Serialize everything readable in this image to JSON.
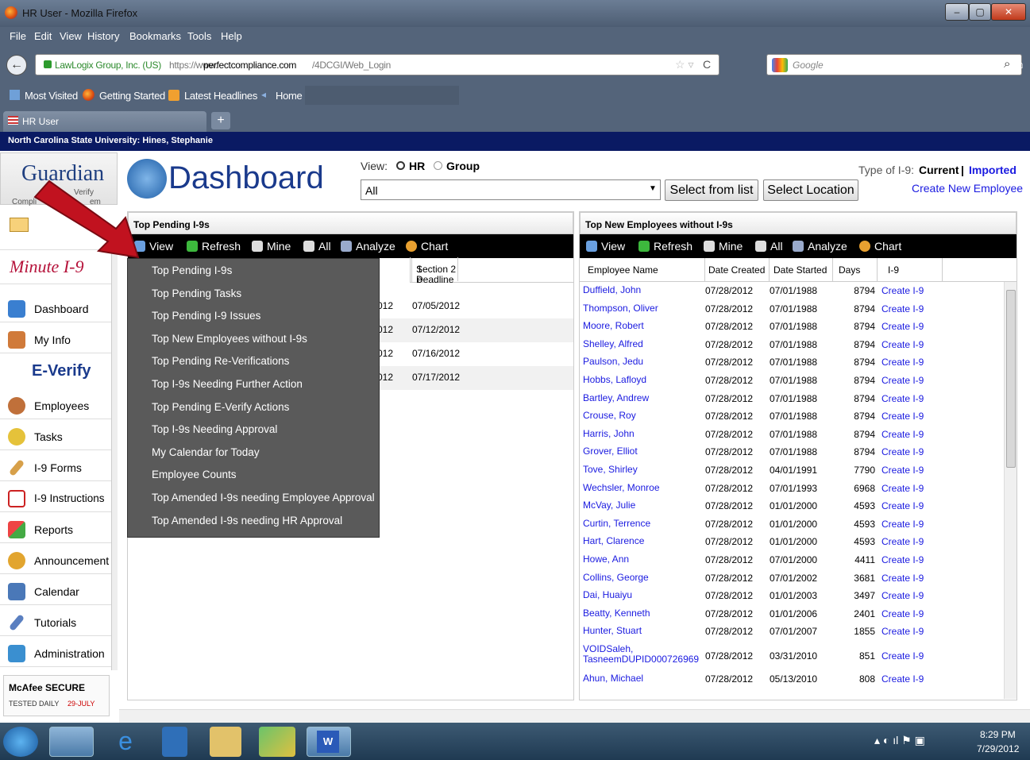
{
  "window": {
    "title": "HR User - Mozilla Firefox",
    "controls": [
      "–",
      "▢",
      "✕"
    ]
  },
  "menubar": [
    "File",
    "Edit",
    "View",
    "History",
    "Bookmarks",
    "Tools",
    "Help"
  ],
  "navbar": {
    "site_id": "LawLogix Group, Inc. (US)",
    "url_prefix": "https://www.",
    "url_domain": "perfectcompliance.com",
    "url_path": "/4DCGI/Web_Login",
    "search_placeholder": "Google"
  },
  "bookmarks": [
    "Most Visited",
    "Getting Started",
    "Latest Headlines",
    "Home"
  ],
  "tab": {
    "label": "HR User",
    "new_tab": "+"
  },
  "university_bar": "North Carolina State University: Hines, Stephanie",
  "sidebar": {
    "logo_text": "Guardian",
    "logo_sub1": "Verify",
    "logo_sub2": "Compli",
    "logo_sub3": "em",
    "minute_logo": "Minute I-9",
    "everify_logo": "E-Verify",
    "items": [
      {
        "label": "Dashboard"
      },
      {
        "label": "My Info"
      },
      {
        "label": "Employees"
      },
      {
        "label": "Tasks"
      },
      {
        "label": "I-9 Forms"
      },
      {
        "label": "I-9 Instructions"
      },
      {
        "label": "Reports"
      },
      {
        "label": "Announcement"
      },
      {
        "label": "Calendar"
      },
      {
        "label": "Tutorials"
      },
      {
        "label": "Administration"
      }
    ],
    "mcafee_title": "McAfee SECURE",
    "mcafee_sub": "TESTED DAILY",
    "mcafee_date": "29-JULY"
  },
  "header": {
    "title": "Dashboard",
    "view_label": "View:",
    "view_options": [
      "HR",
      "Group"
    ],
    "select_value": "All",
    "select_from_list": "Select from list",
    "select_location": "Select Location",
    "type_label": "Type of I-9:",
    "type_current": "Current",
    "type_sep": "|",
    "type_imported": "Imported",
    "create_new": "Create New Employee"
  },
  "left_panel": {
    "title": "Top Pending I-9s",
    "toolbar": [
      "View",
      "Refresh",
      "Mine",
      "All",
      "Analyze",
      "Chart"
    ],
    "col_partial": "1\ne",
    "col_section2": "Section 2\nDeadline",
    "rows": [
      {
        "partial": "012",
        "deadline": "07/05/2012"
      },
      {
        "partial": "012",
        "deadline": "07/12/2012"
      },
      {
        "partial": "012",
        "deadline": "07/16/2012"
      },
      {
        "partial": "012",
        "deadline": "07/17/2012"
      }
    ]
  },
  "dropdown_menu": [
    "Top Pending I-9s",
    "Top Pending Tasks",
    "Top Pending I-9 Issues",
    "Top New Employees without I-9s",
    "Top Pending Re-Verifications",
    "Top I-9s Needing Further Action",
    "Top Pending E-Verify Actions",
    "Top I-9s Needing Approval",
    "My Calendar for Today",
    "Employee Counts",
    "Top Amended I-9s needing Employee Approval",
    "Top Amended I-9s needing HR Approval"
  ],
  "right_panel": {
    "title": "Top New Employees without I-9s",
    "toolbar": [
      "View",
      "Refresh",
      "Mine",
      "All",
      "Analyze",
      "Chart"
    ],
    "columns": [
      "Employee Name",
      "Date Created",
      "Date Started",
      "Days",
      "I-9"
    ],
    "rows": [
      [
        "Duffield, John",
        "07/28/2012",
        "07/01/1988",
        "8794",
        "Create I-9"
      ],
      [
        "Thompson, Oliver",
        "07/28/2012",
        "07/01/1988",
        "8794",
        "Create I-9"
      ],
      [
        "Moore, Robert",
        "07/28/2012",
        "07/01/1988",
        "8794",
        "Create I-9"
      ],
      [
        "Shelley, Alfred",
        "07/28/2012",
        "07/01/1988",
        "8794",
        "Create I-9"
      ],
      [
        "Paulson, Jedu",
        "07/28/2012",
        "07/01/1988",
        "8794",
        "Create I-9"
      ],
      [
        "Hobbs, Lafloyd",
        "07/28/2012",
        "07/01/1988",
        "8794",
        "Create I-9"
      ],
      [
        "Bartley, Andrew",
        "07/28/2012",
        "07/01/1988",
        "8794",
        "Create I-9"
      ],
      [
        "Crouse, Roy",
        "07/28/2012",
        "07/01/1988",
        "8794",
        "Create I-9"
      ],
      [
        "Harris, John",
        "07/28/2012",
        "07/01/1988",
        "8794",
        "Create I-9"
      ],
      [
        "Grover, Elliot",
        "07/28/2012",
        "07/01/1988",
        "8794",
        "Create I-9"
      ],
      [
        "Tove, Shirley",
        "07/28/2012",
        "04/01/1991",
        "7790",
        "Create I-9"
      ],
      [
        "Wechsler, Monroe",
        "07/28/2012",
        "07/01/1993",
        "6968",
        "Create I-9"
      ],
      [
        "McVay, Julie",
        "07/28/2012",
        "01/01/2000",
        "4593",
        "Create I-9"
      ],
      [
        "Curtin, Terrence",
        "07/28/2012",
        "01/01/2000",
        "4593",
        "Create I-9"
      ],
      [
        "Hart, Clarence",
        "07/28/2012",
        "01/01/2000",
        "4593",
        "Create I-9"
      ],
      [
        "Howe, Ann",
        "07/28/2012",
        "07/01/2000",
        "4411",
        "Create I-9"
      ],
      [
        "Collins, George",
        "07/28/2012",
        "07/01/2002",
        "3681",
        "Create I-9"
      ],
      [
        "Dai, Huaiyu",
        "07/28/2012",
        "01/01/2003",
        "3497",
        "Create I-9"
      ],
      [
        "Beatty, Kenneth",
        "07/28/2012",
        "01/01/2006",
        "2401",
        "Create I-9"
      ],
      [
        "Hunter, Stuart",
        "07/28/2012",
        "07/01/2007",
        "1855",
        "Create I-9"
      ],
      [
        "VOIDSaleh, TasneemDUPID000726969",
        "07/28/2012",
        "03/31/2010",
        "851",
        "Create I-9"
      ],
      [
        "Ahun, Michael",
        "07/28/2012",
        "05/13/2010",
        "808",
        "Create I-9"
      ]
    ]
  },
  "taskbar": {
    "time": "8:29 PM",
    "date": "7/29/2012"
  },
  "colors": {
    "titlebar": "#4d5d73",
    "uni_bar": "#0a1a63",
    "link": "#1a1ae0",
    "arrow": "#c1121f",
    "menu_bg": "#5a5a5a"
  }
}
